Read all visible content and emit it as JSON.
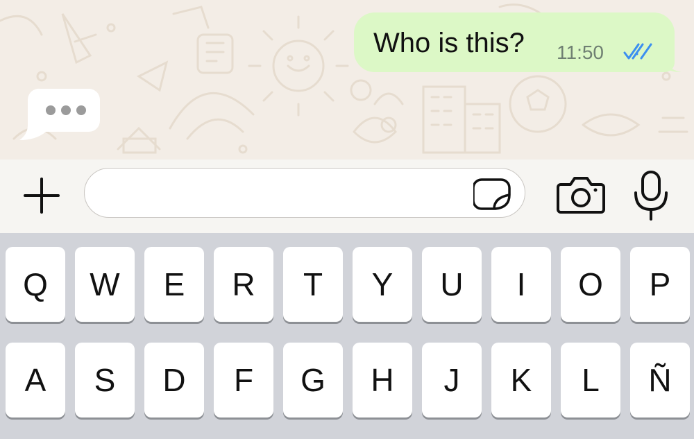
{
  "chat": {
    "outgoing_message": {
      "text": "Who is this?",
      "time": "11:50",
      "status": "read",
      "status_color": "#3b8ff0"
    },
    "typing_indicator": {
      "dots": 3
    }
  },
  "composer": {
    "input_value": "",
    "icons": [
      "plus-icon",
      "sticker-icon",
      "camera-icon",
      "microphone-icon"
    ]
  },
  "keyboard": {
    "row1": [
      "Q",
      "W",
      "E",
      "R",
      "T",
      "Y",
      "U",
      "I",
      "O",
      "P"
    ],
    "row2": [
      "A",
      "S",
      "D",
      "F",
      "G",
      "H",
      "J",
      "K",
      "L",
      "Ñ"
    ]
  },
  "colors": {
    "outgoing_bubble": "#dcf8c6",
    "chat_background": "#f3ede6",
    "keyboard_background": "#d1d3d9"
  }
}
